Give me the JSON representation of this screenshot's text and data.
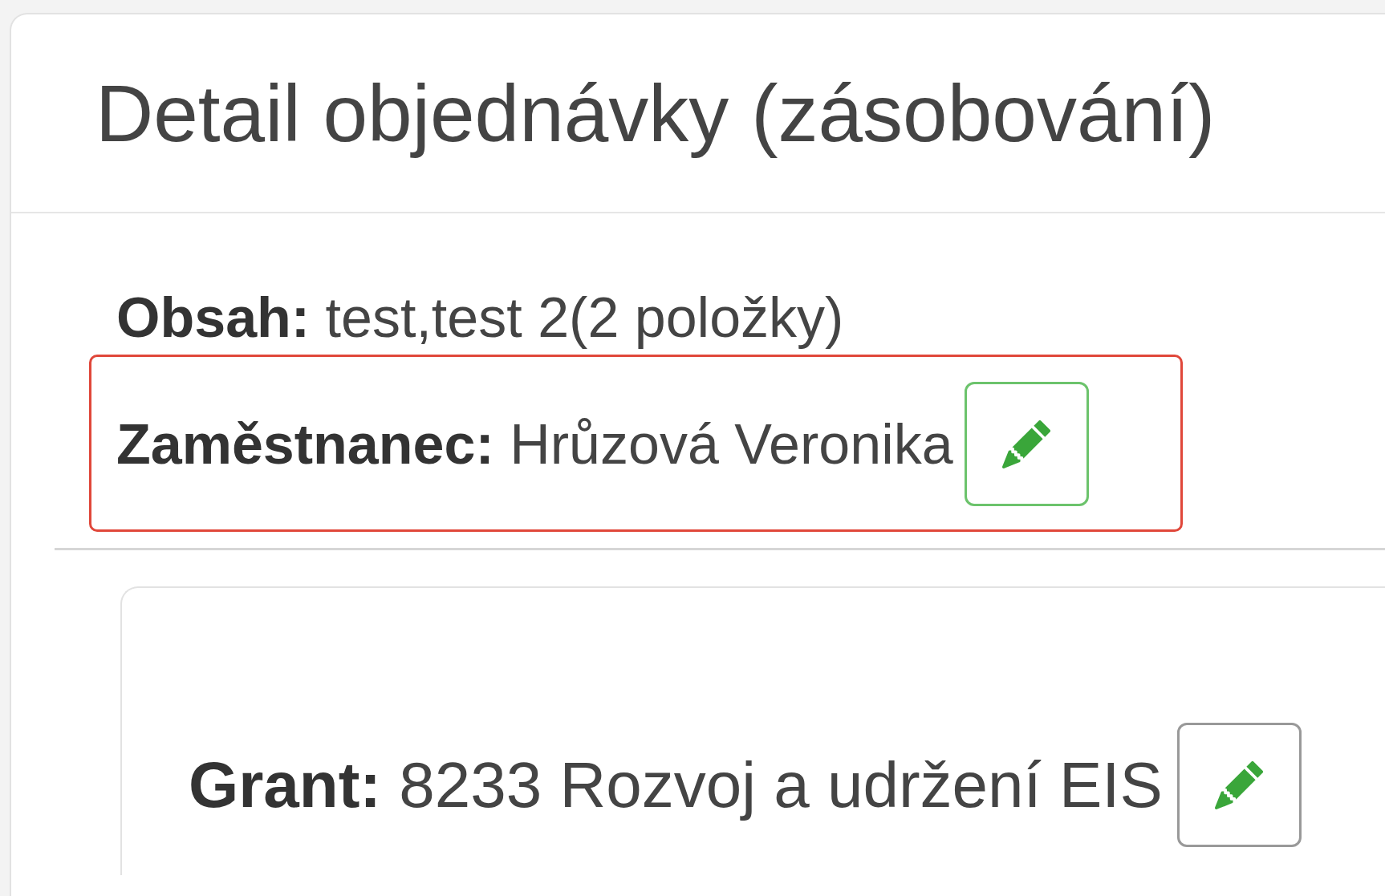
{
  "title": "Detail objednávky (zásobování)",
  "fields": [
    {
      "label": "Obsah:",
      "value": "test,test 2(2 položky)",
      "editable": false,
      "highlighted": false
    },
    {
      "label": "Zaměstnanec:",
      "value": "Hrůzová Veronika",
      "editable": true,
      "highlighted": true
    }
  ],
  "grant": {
    "label": "Grant:",
    "value": "8233 Rozvoj a udržení EIS",
    "editable": true,
    "highlighted": false
  }
}
